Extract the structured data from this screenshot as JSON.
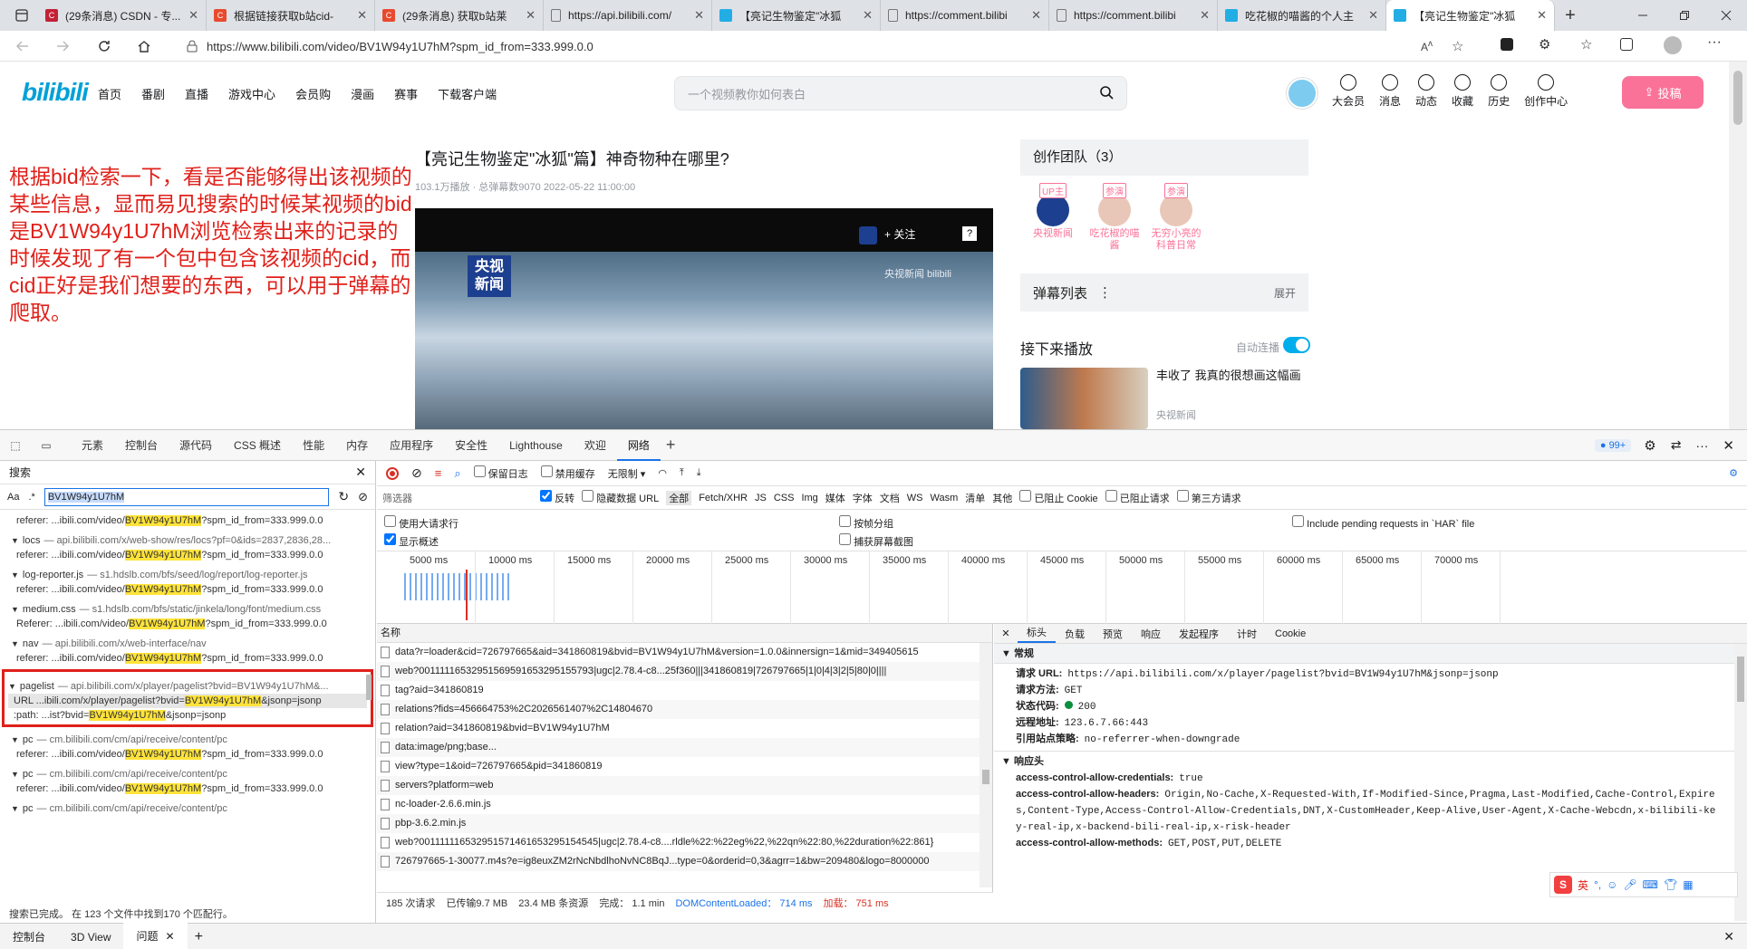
{
  "browser": {
    "tabs": [
      {
        "title": "(29条消息) CSDN - 专...",
        "icon_color": "#c32136",
        "icon": "C"
      },
      {
        "title": "根据链接获取b站cid-",
        "icon_color": "#e84a2f",
        "icon": "C"
      },
      {
        "title": "(29条消息) 获取b站莱",
        "icon_color": "#e84a2f",
        "icon": "C"
      },
      {
        "title": "https://api.bilibili.com/",
        "icon_color": "#888",
        "icon": "doc"
      },
      {
        "title": "【亮记生物鉴定\"冰狐",
        "icon_color": "#23ade5",
        "icon": "tv"
      },
      {
        "title": "https://comment.bilibi",
        "icon_color": "#888",
        "icon": "doc"
      },
      {
        "title": "https://comment.bilibi",
        "icon_color": "#888",
        "icon": "doc"
      },
      {
        "title": "吃花椒的喵酱的个人主",
        "icon_color": "#23ade5",
        "icon": "tv"
      },
      {
        "title": "【亮记生物鉴定\"冰狐",
        "icon_color": "#23ade5",
        "icon": "tv"
      }
    ],
    "url": "https://www.bilibili.com/video/BV1W94y1U7hM?spm_id_from=333.999.0.0"
  },
  "site": {
    "logo": "bilibili",
    "nav": [
      "首页",
      "番剧",
      "直播",
      "游戏中心",
      "会员购",
      "漫画",
      "赛事",
      "下载客户端"
    ],
    "search_placeholder": "一个视频教你如何表白",
    "right_nav": [
      "大会员",
      "消息",
      "动态",
      "收藏",
      "历史",
      "创作中心"
    ],
    "upload": "投稿"
  },
  "annotation": "根据bid检索一下，看是否能够得出该视频的某些信息，显而易见搜索的时候某视频的bid是BV1W94y1U7hM浏览检索出来的记录的时候发现了有一个包中包含该视频的cid，而cid正好是我们想要的东西，可以用于弹幕的爬取。",
  "video": {
    "title": "【亮记生物鉴定\"冰狐\"篇】神奇物种在哪里?",
    "meta": "103.1万播放 · 总弹幕数9070   2022-05-22 11:00:00",
    "follow": "+ 关注",
    "channel_badge": "央视新闻",
    "logo_text": "央视\n新闻",
    "watermark": "央视新闻 bilibili"
  },
  "sidebar": {
    "team_title": "创作团队（3）",
    "members": [
      {
        "name": "央视新闻",
        "badge": "UP主"
      },
      {
        "name": "吃花椒的喵酱",
        "badge": "参演"
      },
      {
        "name": "无穷小亮的科普日常",
        "badge": "参演"
      }
    ],
    "danmu_title": "弹幕列表",
    "danmu_expand": "展开",
    "next_title": "接下来播放",
    "autoplay": "自动连播",
    "next_video_title": "丰收了 我真的很想画这幅画",
    "next_video_author": "央视新闻"
  },
  "devtools": {
    "tabs": [
      "元素",
      "控制台",
      "源代码",
      "CSS 概述",
      "性能",
      "内存",
      "应用程序",
      "安全性",
      "Lighthouse",
      "欢迎",
      "网络"
    ],
    "issues_badge": "99+",
    "search_label": "搜索",
    "search_query": "BV1W94y1U7hM",
    "search_results": [
      {
        "type": "ref",
        "text": "referer:  ...ibili.com/video/",
        "hl": "BV1W94y1U7hM",
        "tail": "?spm_id_from=333.999.0.0"
      },
      {
        "type": "group",
        "name": "locs",
        "src": "— api.bilibili.com/x/web-show/res/locs?pf=0&ids=2837,2836,28..."
      },
      {
        "type": "ref",
        "text": "referer:  ...ibili.com/video/",
        "hl": "BV1W94y1U7hM",
        "tail": "?spm_id_from=333.999.0.0"
      },
      {
        "type": "group",
        "name": "log-reporter.js",
        "src": "— s1.hdslb.com/bfs/seed/log/report/log-reporter.js"
      },
      {
        "type": "ref",
        "text": "referer:  ...ibili.com/video/",
        "hl": "BV1W94y1U7hM",
        "tail": "?spm_id_from=333.999.0.0"
      },
      {
        "type": "group",
        "name": "medium.css",
        "src": "— s1.hdslb.com/bfs/static/jinkela/long/font/medium.css"
      },
      {
        "type": "ref",
        "text": "Referer:  ...ibili.com/video/",
        "hl": "BV1W94y1U7hM",
        "tail": "?spm_id_from=333.999.0.0"
      },
      {
        "type": "group",
        "name": "nav",
        "src": "— api.bilibili.com/x/web-interface/nav"
      },
      {
        "type": "ref",
        "text": "referer:  ...ibili.com/video/",
        "hl": "BV1W94y1U7hM",
        "tail": "?spm_id_from=333.999.0.0"
      }
    ],
    "pagelist_group": {
      "name": "pagelist",
      "src": "— api.bilibili.com/x/player/pagelist?bvid=BV1W94y1U7hM&..."
    },
    "pagelist_rows": [
      {
        "text": "URL   ...ibili.com/x/player/pagelist?bvid=",
        "hl": "BV1W94y1U7hM",
        "tail": "&jsonp=jsonp"
      },
      {
        "text": ":path:   ...ist?bvid=",
        "hl": "BV1W94y1U7hM",
        "tail": "&jsonp=jsonp"
      }
    ],
    "search_results_after": [
      {
        "type": "group",
        "name": "pc",
        "src": "— cm.bilibili.com/cm/api/receive/content/pc"
      },
      {
        "type": "ref",
        "text": "referer:  ...ibili.com/video/",
        "hl": "BV1W94y1U7hM",
        "tail": "?spm_id_from=333.999.0.0"
      },
      {
        "type": "group",
        "name": "pc",
        "src": "— cm.bilibili.com/cm/api/receive/content/pc"
      },
      {
        "type": "ref",
        "text": "referer:  ...ibili.com/video/",
        "hl": "BV1W94y1U7hM",
        "tail": "?spm_id_from=333.999.0.0"
      },
      {
        "type": "group",
        "name": "pc",
        "src": "— cm.bilibili.com/cm/api/receive/content/pc"
      }
    ],
    "search_status": "搜索已完成。     在 123 个文件中找到170 个匹配行。",
    "net_toolbar": {
      "preserve": "保留日志",
      "disable_cache": "禁用缓存",
      "throttle": "无限制"
    },
    "filter_placeholder": "筛选器",
    "filter_opts": [
      "反转",
      "隐藏数据 URL",
      "全部",
      "Fetch/XHR",
      "JS",
      "CSS",
      "Img",
      "媒体",
      "字体",
      "文档",
      "WS",
      "Wasm",
      "清单",
      "其他",
      "已阻止 Cookie",
      "已阻止请求",
      "第三方请求"
    ],
    "opt_big_rows": "使用大请求行",
    "opt_group": "按帧分组",
    "opt_har": "Include pending requests in `HAR` file",
    "opt_overview": "显示概述",
    "opt_screenshot": "捕获屏幕截图",
    "timeline_ticks": [
      "5000 ms",
      "10000 ms",
      "15000 ms",
      "20000 ms",
      "25000 ms",
      "30000 ms",
      "35000 ms",
      "40000 ms",
      "45000 ms",
      "50000 ms",
      "55000 ms",
      "60000 ms",
      "65000 ms",
      "70000 ms"
    ],
    "col_name": "名称",
    "requests": [
      "data?r=loader&cid=726797665&aid=341860819&bvid=BV1W94y1U7hM&version=1.0.0&innersign=1&mid=349405615",
      "web?0011111653295156959165329515579З|ugc|2.78.4-c8...25f360|||341860819|726797665|1|0|4|3|2|5|80|0||||",
      "tag?aid=341860819",
      "relations?fids=456664753%2C2026561407%2C14804670",
      "relation?aid=341860819&bvid=BV1W94y1U7hM",
      "data:image/png;base...",
      "view?type=1&oid=726797665&pid=341860819",
      "servers?platform=web",
      "nc-loader-2.6.6.min.js",
      "pbp-3.6.2.min.js",
      "web?001111116532951571461653295154545|ugc|2.78.4-c8....rldle%22:%22eg%22,%22qn%22:80,%22duration%22:861}",
      "726797665-1-30077.m4s?e=ig8euxZM2rNcNbdlhoNvNC8BqJ...type=0&orderid=0,3&agrr=1&bw=209480&logo=8000000"
    ],
    "status": {
      "count": "185 次请求",
      "transferred": "已传输9.7 MB",
      "resources": "23.4 MB 条资源",
      "finish": "完成： 1.1 min",
      "dcl": "DOMContentLoaded： 714 ms",
      "load": "加载： 751 ms"
    },
    "detail_tabs": [
      "标头",
      "负载",
      "预览",
      "响应",
      "发起程序",
      "计时",
      "Cookie"
    ],
    "general_title": "常规",
    "general": [
      {
        "k": "请求 URL:",
        "v": "https://api.bilibili.com/x/player/pagelist?bvid=BV1W94y1U7hM&jsonp=jsonp"
      },
      {
        "k": "请求方法:",
        "v": "GET"
      },
      {
        "k": "状态代码:",
        "v": "200"
      },
      {
        "k": "远程地址:",
        "v": "123.6.7.66:443"
      },
      {
        "k": "引用站点策略:",
        "v": "no-referrer-when-downgrade"
      }
    ],
    "resp_title": "响应头",
    "resp_headers": [
      {
        "k": "access-control-allow-credentials:",
        "v": "true"
      },
      {
        "k": "access-control-allow-headers:",
        "v": "Origin,No-Cache,X-Requested-With,If-Modified-Since,Pragma,Last-Modified,Cache-Control,Expires,Content-Type,Access-Control-Allow-Credentials,DNT,X-CustomHeader,Keep-Alive,User-Agent,X-Cache-Webcdn,x-bilibili-key-real-ip,x-backend-bili-real-ip,x-risk-header"
      },
      {
        "k": "access-control-allow-methods:",
        "v": "GET,POST,PUT,DELETE"
      }
    ],
    "bottom_tabs": [
      "控制台",
      "3D View",
      "问题"
    ],
    "ime_label": "英"
  }
}
